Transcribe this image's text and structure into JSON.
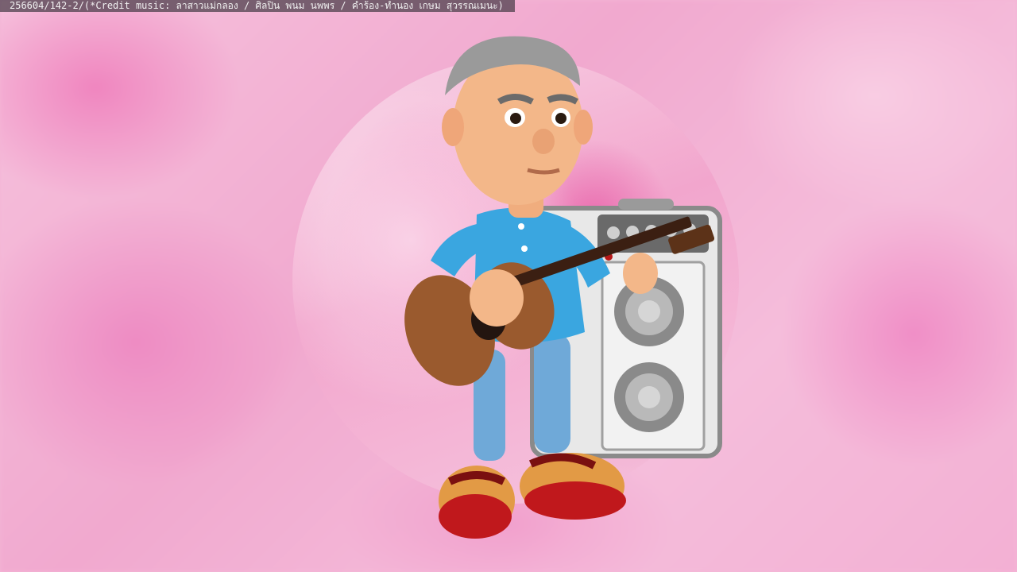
{
  "caption": {
    "text": "256604/142-2/(*Credit music: ลาสาวแม่กลอง / ศิลปิน พนม นพพร / คำร้อง-ทำนอง เกษม สุวรรณเมนะ)"
  },
  "colors": {
    "background_pink": "#f4b6d6",
    "shirt_blue": "#3aa6e0",
    "pants_blue": "#6fa9d8",
    "guitar_brown": "#9a5a2e",
    "amp_grey": "#d9d9d9",
    "shoe_red": "#c0181c"
  },
  "icons": [
    "guitar-icon",
    "amplifier-icon",
    "character-figure"
  ]
}
